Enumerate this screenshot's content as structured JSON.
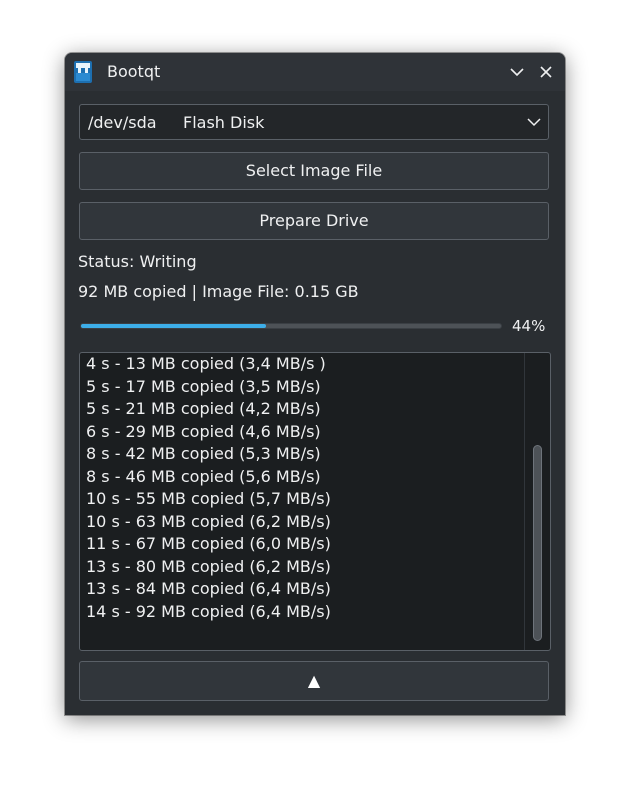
{
  "window": {
    "title": "Bootqt",
    "app_icon": "bootqt-app-icon",
    "minimize_icon": "chevron-down-icon",
    "close_icon": "close-icon"
  },
  "drive_select": {
    "device": "/dev/sda",
    "model": "Flash Disk",
    "icon": "chevron-down-icon"
  },
  "buttons": {
    "select_image": "Select Image File",
    "prepare_drive": "Prepare Drive",
    "toggle_log": "▲"
  },
  "status": {
    "text": "Status: Writing",
    "info": "92 MB copied | Image File: 0.15 GB"
  },
  "progress": {
    "value": 0.44,
    "label": "44%"
  },
  "log": {
    "lines": [
      "4 s - 13 MB copied (3,4 MB/s )",
      "5 s - 17 MB copied (3,5 MB/s)",
      "5 s - 21 MB copied (4,2 MB/s)",
      "6 s - 29 MB copied (4,6 MB/s)",
      "8 s - 42 MB copied (5,3 MB/s)",
      "8 s - 46 MB copied (5,6 MB/s)",
      "10 s - 55 MB copied (5,7 MB/s)",
      "10 s - 63 MB copied (6,2 MB/s)",
      "11 s - 67 MB copied (6,0 MB/s)",
      "13 s - 80 MB copied (6,2 MB/s)",
      "13 s - 84 MB copied (6,4 MB/s)",
      "14 s - 92 MB copied (6,4 MB/s)"
    ]
  },
  "colors": {
    "accent": "#3daee9",
    "window_bg": "#2a2e32",
    "text": "#eff0f1"
  }
}
